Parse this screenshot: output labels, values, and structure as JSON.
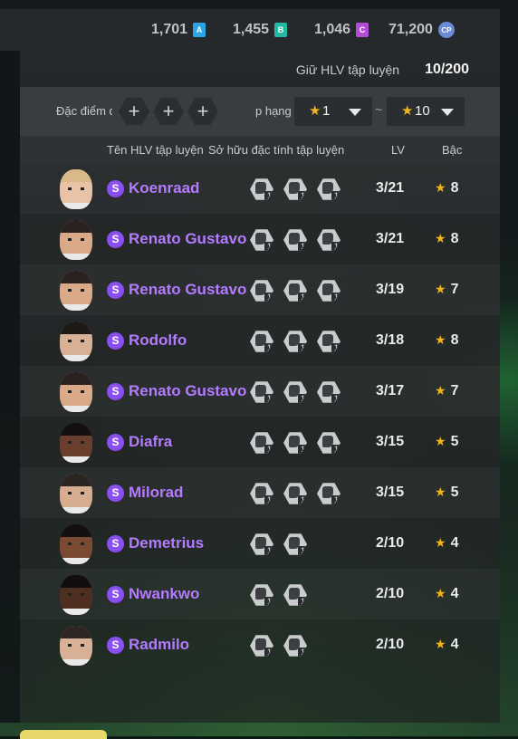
{
  "currency": [
    {
      "value": "1,701",
      "icon_letter": "A",
      "color": "#2aa5e8"
    },
    {
      "value": "1,455",
      "icon_letter": "B",
      "color": "#22b8a3"
    },
    {
      "value": "1,046",
      "icon_letter": "C",
      "color": "#b34bd9"
    },
    {
      "value": "71,200",
      "icon_letter": "CP",
      "color": "#6a8bd8"
    }
  ],
  "holding": {
    "label": "Giữ HLV tập luyện",
    "count": "10/200"
  },
  "filter": {
    "traits_label": "Đặc điểm đ",
    "add_symbol": "+",
    "rank_label": "p hạng",
    "rank_min": "1",
    "rank_max": "10",
    "tilde": "~"
  },
  "columns": {
    "name": "Tên HLV tập luyện",
    "traits": "Sở hữu đặc tính tập luyện",
    "lv": "LV",
    "grade": "Bậc"
  },
  "badge_letter": "S",
  "trait_level": "1",
  "star_glyph": "★",
  "coaches": [
    {
      "name": "Koenraad",
      "lv": "3/21",
      "grade": "8",
      "traits": 3,
      "hair": "#d9b98a",
      "skin": "#e8c3a8"
    },
    {
      "name": "Renato Gustavo",
      "lv": "3/21",
      "grade": "8",
      "traits": 3,
      "hair": "#2a2220",
      "skin": "#d9a988"
    },
    {
      "name": "Renato Gustavo",
      "lv": "3/19",
      "grade": "7",
      "traits": 3,
      "hair": "#2a2220",
      "skin": "#d9a988"
    },
    {
      "name": "Rodolfo",
      "lv": "3/18",
      "grade": "8",
      "traits": 3,
      "hair": "#1e1a18",
      "skin": "#d8b095"
    },
    {
      "name": "Renato Gustavo",
      "lv": "3/17",
      "grade": "7",
      "traits": 3,
      "hair": "#2a2220",
      "skin": "#d9a988"
    },
    {
      "name": "Diafra",
      "lv": "3/15",
      "grade": "5",
      "traits": 3,
      "hair": "#141010",
      "skin": "#6b3f2e"
    },
    {
      "name": "Milorad",
      "lv": "3/15",
      "grade": "5",
      "traits": 3,
      "hair": "#2b2522",
      "skin": "#d6ad90"
    },
    {
      "name": "Demetrius",
      "lv": "2/10",
      "grade": "4",
      "traits": 2,
      "hair": "#151010",
      "skin": "#7a4a33"
    },
    {
      "name": "Nwankwo",
      "lv": "2/10",
      "grade": "4",
      "traits": 2,
      "hair": "#120e0e",
      "skin": "#4e2f22"
    },
    {
      "name": "Radmilo",
      "lv": "2/10",
      "grade": "4",
      "traits": 2,
      "hair": "#2e2723",
      "skin": "#d8b096"
    }
  ]
}
